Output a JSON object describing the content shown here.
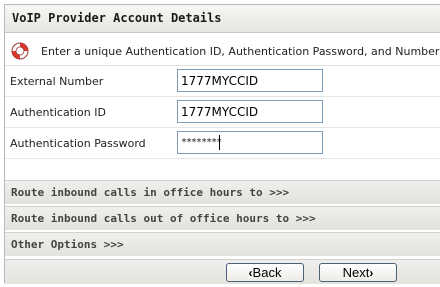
{
  "header": {
    "title": "VoIP Provider Account Details"
  },
  "info": {
    "icon": "lifebuoy-icon",
    "text": "Enter a unique Authentication ID, Authentication Password, and Number for this"
  },
  "fields": {
    "external_number": {
      "label": "External Number",
      "value": "1777MYCCID"
    },
    "auth_id": {
      "label": "Authentication ID",
      "value": "1777MYCCID"
    },
    "auth_password": {
      "label": "Authentication Password",
      "masked_value": "********"
    }
  },
  "sections": {
    "office_hours": "Route inbound calls in office hours to >>>",
    "out_of_office": "Route inbound calls out of office hours to >>>",
    "other_options": "Other Options >>>"
  },
  "buttons": {
    "back": {
      "chevron": "‹",
      "label": "Back"
    },
    "next": {
      "label": "Next",
      "chevron": "›"
    }
  },
  "colors": {
    "input_border": "#7f9db9",
    "icon_red": "#d8362f",
    "header_bg": "#e6e5e1"
  }
}
